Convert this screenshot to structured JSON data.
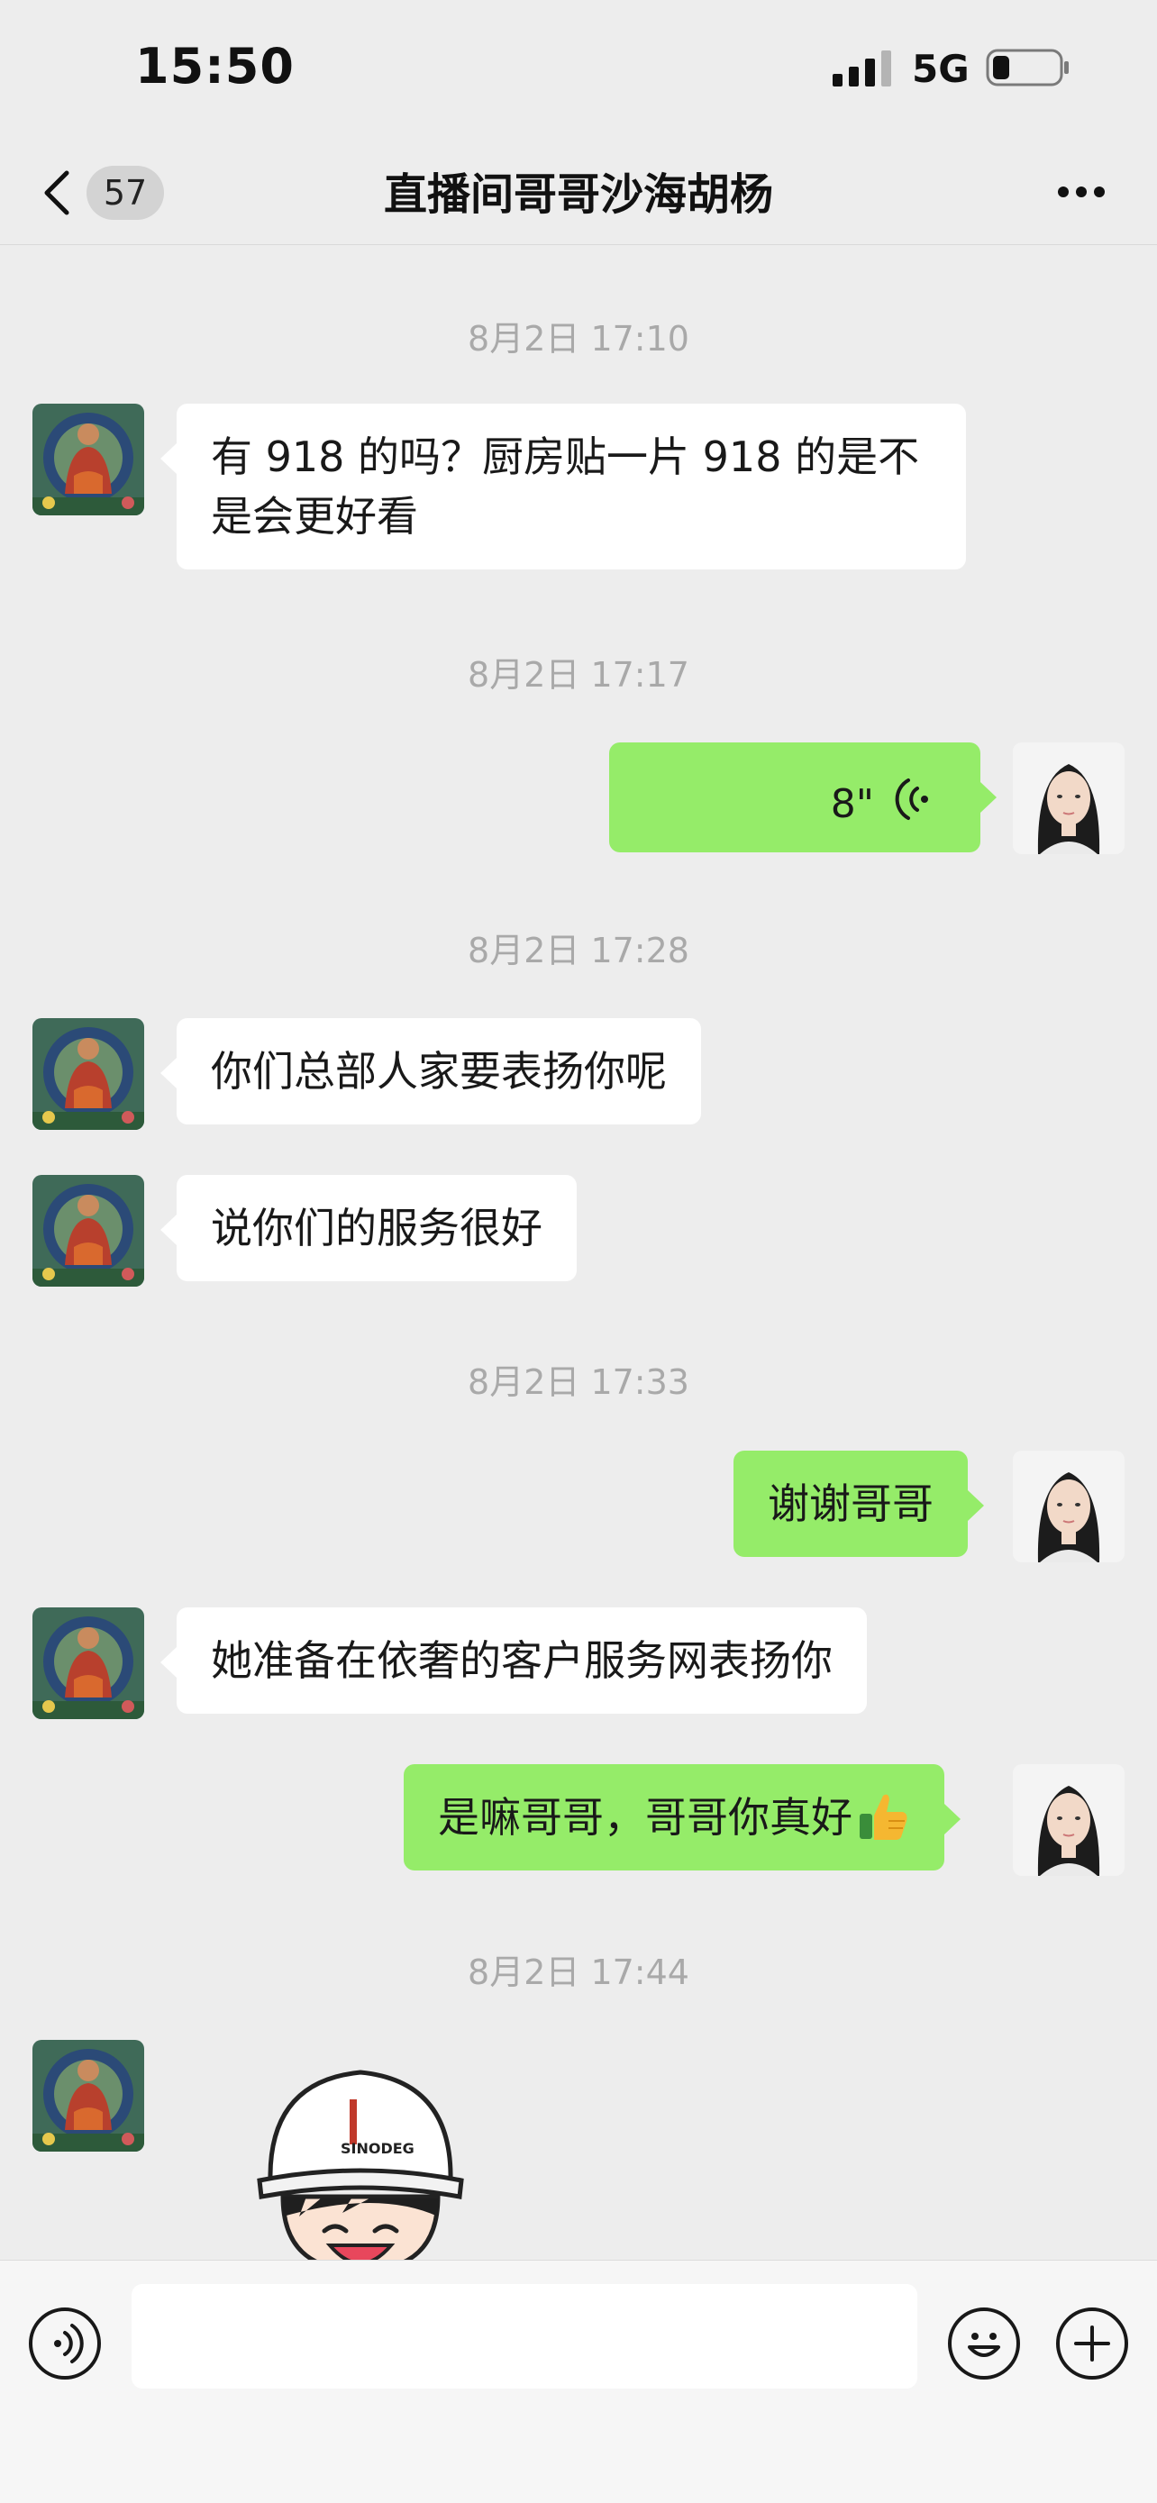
{
  "status_bar": {
    "time": "15:50",
    "network": "5G",
    "icons": [
      "signal-icon",
      "battery-icon"
    ]
  },
  "nav": {
    "unread_count": "57",
    "title": "直播间哥哥沙海胡杨",
    "icons": [
      "back-chevron-icon",
      "more-icon"
    ]
  },
  "messages": [
    {
      "type": "timestamp",
      "text": "8月2日 17:10"
    },
    {
      "type": "text",
      "side": "left",
      "lines": [
        "有 918 的吗？厨房贴一片 918 的是不",
        "是会更好看"
      ]
    },
    {
      "type": "timestamp",
      "text": "8月2日 17:17"
    },
    {
      "type": "voice",
      "side": "right",
      "duration": "8\""
    },
    {
      "type": "timestamp",
      "text": "8月2日 17:28"
    },
    {
      "type": "text",
      "side": "left",
      "text": "你们总部人家要表扬你呢"
    },
    {
      "type": "text",
      "side": "left",
      "text": "说你们的服务很好"
    },
    {
      "type": "timestamp",
      "text": "8月2日 17:33"
    },
    {
      "type": "text",
      "side": "right",
      "text": "谢谢哥哥"
    },
    {
      "type": "text",
      "side": "left",
      "text": "她准备在依奢的客户服务网表扬你"
    },
    {
      "type": "text",
      "side": "right",
      "text": "是嘛哥哥，哥哥你真好",
      "emoji": "thumbs-up-icon"
    },
    {
      "type": "timestamp",
      "text": "8月2日 17:44"
    },
    {
      "type": "sticker",
      "side": "left",
      "sticker": "hard-hat-boy-sticker",
      "logo_text": "SINODEG"
    }
  ],
  "input_bar": {
    "placeholder": "",
    "icons": [
      "voice-input-icon",
      "emoji-icon",
      "add-icon"
    ]
  },
  "colors": {
    "background": "#ededed",
    "incoming_bubble": "#ffffff",
    "outgoing_bubble": "#95ec69",
    "timestamp_text": "#a9a9a9"
  }
}
